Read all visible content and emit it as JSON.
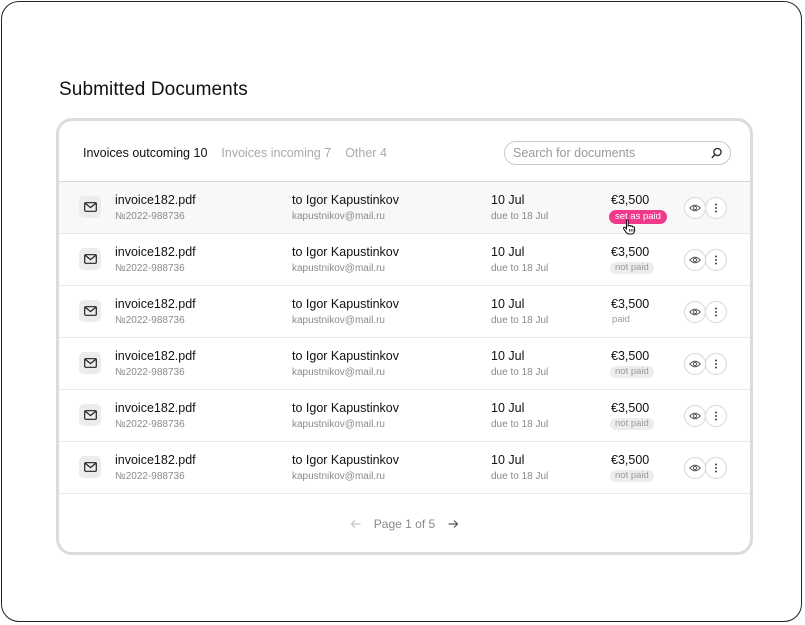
{
  "page": {
    "title": "Submitted Documents"
  },
  "tabs": [
    {
      "label": "Invoices outcoming",
      "count": "10",
      "active": true
    },
    {
      "label": "Invoices incoming",
      "count": "7",
      "active": false
    },
    {
      "label": "Other",
      "count": "4",
      "active": false
    }
  ],
  "search": {
    "placeholder": "Search for documents",
    "value": ""
  },
  "rows": [
    {
      "file": "invoice182.pdf",
      "number": "№2022-988736",
      "recipient": "to Igor Kapustinkov",
      "email": "kapustnikov@mail.ru",
      "date": "10 Jul",
      "due": "due to 18 Jul",
      "amount": "€3,500",
      "status": "set as paid",
      "status_type": "set-paid",
      "hover": true
    },
    {
      "file": "invoice182.pdf",
      "number": "№2022-988736",
      "recipient": "to Igor Kapustinkov",
      "email": "kapustnikov@mail.ru",
      "date": "10 Jul",
      "due": "due to 18 Jul",
      "amount": "€3,500",
      "status": "not paid",
      "status_type": "not-paid",
      "hover": false
    },
    {
      "file": "invoice182.pdf",
      "number": "№2022-988736",
      "recipient": "to Igor Kapustinkov",
      "email": "kapustnikov@mail.ru",
      "date": "10 Jul",
      "due": "due to 18 Jul",
      "amount": "€3,500",
      "status": "paid",
      "status_type": "paid",
      "hover": false
    },
    {
      "file": "invoice182.pdf",
      "number": "№2022-988736",
      "recipient": "to Igor Kapustinkov",
      "email": "kapustnikov@mail.ru",
      "date": "10 Jul",
      "due": "due to 18 Jul",
      "amount": "€3,500",
      "status": "not paid",
      "status_type": "not-paid",
      "hover": false
    },
    {
      "file": "invoice182.pdf",
      "number": "№2022-988736",
      "recipient": "to Igor Kapustinkov",
      "email": "kapustnikov@mail.ru",
      "date": "10 Jul",
      "due": "due to 18 Jul",
      "amount": "€3,500",
      "status": "not paid",
      "status_type": "not-paid",
      "hover": false
    },
    {
      "file": "invoice182.pdf",
      "number": "№2022-988736",
      "recipient": "to Igor Kapustinkov",
      "email": "kapustnikov@mail.ru",
      "date": "10 Jul",
      "due": "due to 18 Jul",
      "amount": "€3,500",
      "status": "not paid",
      "status_type": "not-paid",
      "hover": false
    }
  ],
  "icons": {
    "doc": "envelope-icon",
    "view": "eye-icon",
    "more": "more-vertical-icon",
    "search": "search-icon",
    "prev": "arrow-left-icon",
    "next": "arrow-right-icon",
    "cursor": "hand-pointer-icon"
  },
  "pagination": {
    "label": "Page 1 of 5"
  },
  "colors": {
    "accent": "#f0398b",
    "border": "#dcdcdc",
    "muted": "#8a8a8a"
  }
}
